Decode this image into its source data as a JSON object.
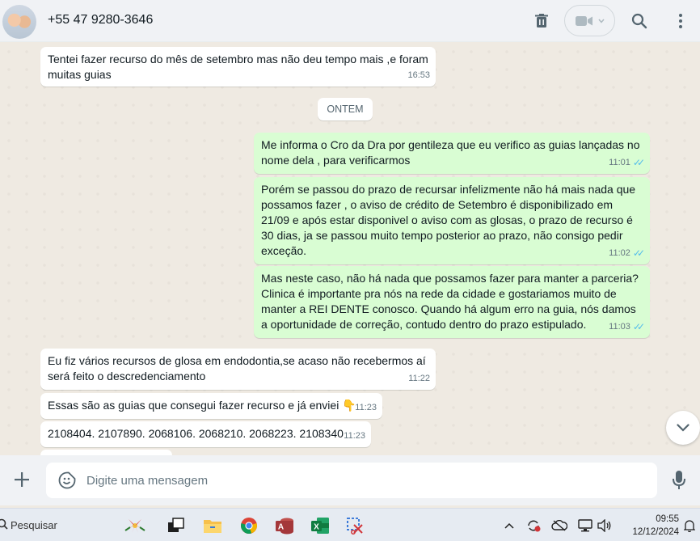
{
  "header": {
    "contact_name": "+55 47 9280-3646"
  },
  "date_divider": "ONTEM",
  "messages": [
    {
      "direction": "in",
      "text": "Tentei fazer recurso do mês de setembro mas não deu tempo mais ,e foram muitas guias",
      "time": "16:53"
    },
    {
      "direction": "out",
      "text": "Me informa o Cro da Dra por gentileza que eu verifico as guias lançadas no nome dela , para verificarmos",
      "time": "11:01"
    },
    {
      "direction": "out",
      "text": "Porém se passou do prazo de recursar infelizmente não há mais nada que possamos fazer , o aviso de crédito de Setembro é disponibilizado em 21/09 e após estar disponivel o aviso com as glosas, o prazo de recurso é 30 dias, ja se passou muito tempo posterior ao prazo, não consigo pedir exceção.",
      "time": "11:02"
    },
    {
      "direction": "out",
      "text": "Mas neste caso, não há nada que possamos fazer para manter a parceria? Clinica é importante pra nós na rede da cidade e gostariamos muito de manter a REI DENTE conosco. Quando há algum erro na guia, nós damos a oportunidade de correção, contudo dentro do prazo estipulado.",
      "time": "11:03"
    },
    {
      "direction": "in",
      "text": "Eu fiz vários recursos de glosa em endodontia,se acaso não recebermos aí será feito o descredenciamento",
      "time": "11:22"
    },
    {
      "direction": "in",
      "text": "Essas são as guias que consegui fazer recurso e já enviei 👇",
      "time": "11:23"
    },
    {
      "direction": "in",
      "text": "2108404. 2107890. 2068106. 2068210. 2068223. 2108340",
      "time": "11:23"
    }
  ],
  "composer": {
    "placeholder": "Digite uma mensagem"
  },
  "taskbar": {
    "search_label": "Pesquisar",
    "time": "09:55",
    "date": "12/12/2024"
  },
  "colors": {
    "outgoing_bubble": "#d9fdd3",
    "incoming_bubble": "#ffffff",
    "read_ticks": "#53bdeb",
    "chat_background": "#efeae2"
  }
}
